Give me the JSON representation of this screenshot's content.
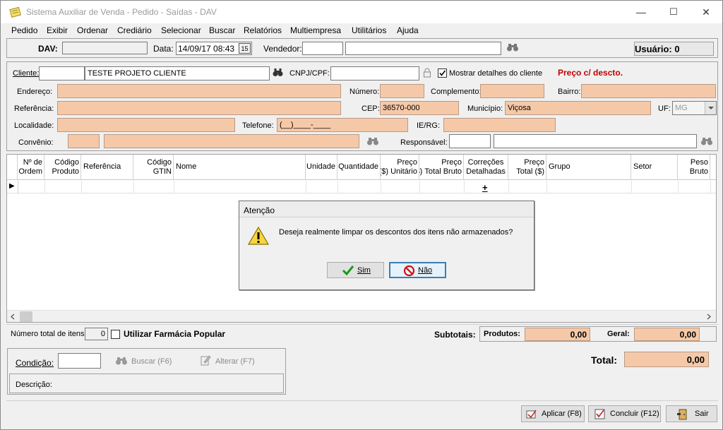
{
  "window": {
    "title": "Sistema Auxiliar de Venda - Pedido - Saídas - DAV",
    "minimize": "—",
    "maximize": "☐",
    "close": "✕"
  },
  "menu": [
    "Pedido",
    "Exibir",
    "Ordenar",
    "Crediário",
    "Selecionar",
    "Buscar",
    "Relatórios",
    "Multiempresa",
    "Utilitários",
    "Ajuda"
  ],
  "top": {
    "dav_label": "DAV:",
    "dav_value": "",
    "data_label": "Data:",
    "data_value": "14/09/17 08:43",
    "calendar_btn": "15",
    "vendedor_label": "Vendedor:",
    "vendedor_code": "",
    "vendedor_name": "",
    "usuario": "Usuário: 0"
  },
  "client": {
    "cliente_label": "Cliente:",
    "cliente_code": "",
    "cliente_name": "TESTE PROJETO CLIENTE",
    "cnpj_label": "CNPJ/CPF:",
    "cnpj_value": "",
    "mostrar_label": "Mostrar detalhes do cliente",
    "mostrar_checked": true,
    "preco_label": "Preço c/ descto.",
    "endereco_label": "Endereço:",
    "endereco": "",
    "numero_label": "Número:",
    "numero": "",
    "complemento_label": "Complemento:",
    "complemento": "",
    "bairro_label": "Bairro:",
    "bairro": "",
    "referencia_label": "Referência:",
    "referencia": "",
    "cep_label": "CEP:",
    "cep": "36570-000",
    "municipio_label": "Município:",
    "municipio": "Viçosa",
    "uf_label": "UF:",
    "uf": "MG",
    "localidade_label": "Localidade:",
    "localidade": "",
    "telefone_label": "Telefone:",
    "telefone": "(__)____-____",
    "ierg_label": "IE/RG:",
    "ierg": "",
    "convenio_label": "Convênio:",
    "convenio_code": "",
    "convenio_name": "",
    "responsavel_label": "Responsável:",
    "responsavel_code": "",
    "responsavel_name": ""
  },
  "grid": {
    "headers": [
      {
        "l1": "Nº de",
        "l2": "Ordem"
      },
      {
        "l1": "Código",
        "l2": "Produto"
      },
      {
        "l1": "Referência",
        "l2": ""
      },
      {
        "l1": "Código",
        "l2": "GTIN"
      },
      {
        "l1": "Nome",
        "l2": ""
      },
      {
        "l1": "Unidade",
        "l2": ""
      },
      {
        "l1": "Quantidade",
        "l2": ""
      },
      {
        "l1": "Preço",
        "l2": "Unitário ($)"
      },
      {
        "l1": "Preço",
        "l2": "Total Bruto ($)"
      },
      {
        "l1": "Correções",
        "l2": "Detalhadas"
      },
      {
        "l1": "Preço",
        "l2": "Total ($)"
      },
      {
        "l1": "Grupo",
        "l2": ""
      },
      {
        "l1": "Setor",
        "l2": ""
      },
      {
        "l1": "Peso",
        "l2": "Bruto"
      }
    ],
    "row_marker": "▶",
    "row_plus": "+"
  },
  "dialog": {
    "title": "Atenção",
    "message": "Deseja realmente limpar os descontos dos itens não armazenados?",
    "yes": "Sim",
    "no": "Não"
  },
  "footer": {
    "num_itens_label": "Número total de itens:",
    "num_itens": "0",
    "farmacia_label": "Utilizar Farmácia Popular",
    "subtotais_label": "Subtotais:",
    "produtos_label": "Produtos:",
    "produtos_value": "0,00",
    "geral_label": "Geral:",
    "geral_value": "0,00",
    "condicao_label": "Condição:",
    "condicao_value": "",
    "buscar_btn": "Buscar (F6)",
    "alterar_btn": "Alterar (F7)",
    "descricao_label": "Descrição:",
    "total_label": "Total:",
    "total_value": "0,00"
  },
  "actions": {
    "aplicar": "Aplicar (F8)",
    "concluir": "Concluir (F12)",
    "sair": "Sair"
  },
  "colors": {
    "peach": "#f5c9a8",
    "red_text": "#c00000",
    "title_gray": "#9a9a9a"
  }
}
